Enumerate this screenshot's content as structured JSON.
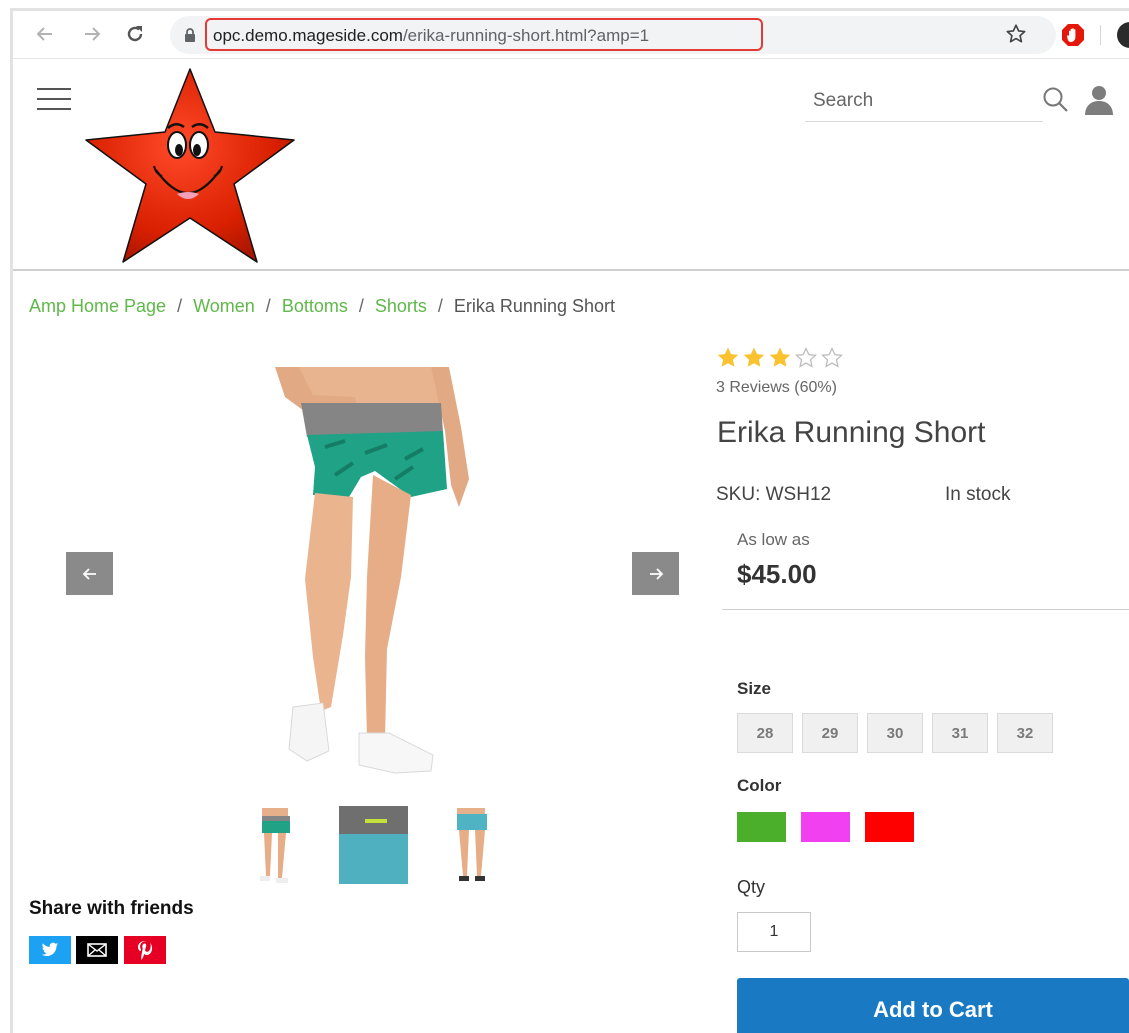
{
  "browser": {
    "url_host": "opc.demo.mageside.com",
    "url_path": "/erika-running-short.html?amp=1",
    "icons": {
      "back": "back-arrow-icon",
      "forward": "forward-arrow-icon",
      "reload": "reload-icon",
      "lock": "lock-icon",
      "bookmark": "star-outline-icon",
      "extension": "stop-sign-icon",
      "profile": "avatar-icon"
    }
  },
  "header": {
    "search": {
      "placeholder": "Search"
    },
    "icons": {
      "menu": "hamburger-icon",
      "search": "search-icon",
      "account": "user-icon"
    }
  },
  "breadcrumb": {
    "links": [
      "Amp Home Page",
      "Women",
      "Bottoms",
      "Shorts"
    ],
    "separator": "/",
    "current": "Erika Running Short"
  },
  "gallery": {
    "thumbnail_count": 3
  },
  "share": {
    "title": "Share with friends",
    "buttons": [
      {
        "icon": "twitter-icon",
        "color": "#1da1f2"
      },
      {
        "icon": "email-icon",
        "color": "#000000"
      },
      {
        "icon": "pinterest-icon",
        "color": "#e60023"
      }
    ]
  },
  "product": {
    "rating": {
      "stars": 3,
      "max": 5
    },
    "reviews": "3 Reviews (60%)",
    "name": "Erika Running Short",
    "sku": "SKU: WSH12",
    "stock": "In stock",
    "price_label": "As low as",
    "price": "$45.00",
    "size_label": "Size",
    "sizes": [
      "28",
      "29",
      "30",
      "31",
      "32"
    ],
    "color_label": "Color",
    "colors": [
      "#4caf2b",
      "#f040f0",
      "#ff0000"
    ],
    "qty_label": "Qty",
    "qty_value": "1",
    "add_to_cart": "Add to Cart"
  },
  "colors": {
    "accent": "#1979c3",
    "breadcrumb_link": "#5fb84a",
    "star": "#f9c22e"
  }
}
